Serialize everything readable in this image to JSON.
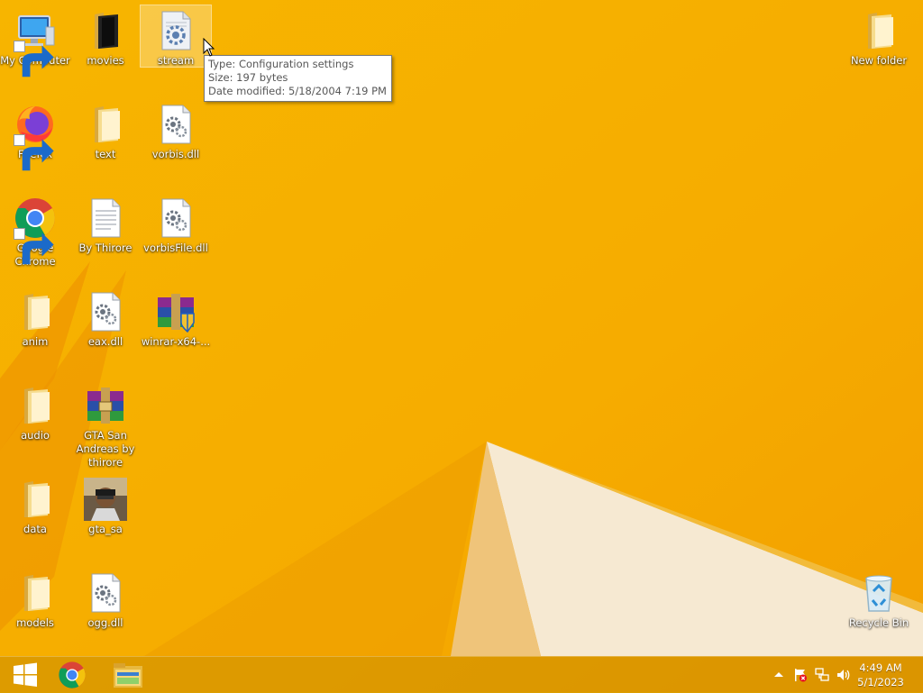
{
  "desktop": {
    "icons": [
      {
        "label": "My Computer",
        "icon": "computer-icon",
        "shortcut": true
      },
      {
        "label": "movies",
        "icon": "folder-icon"
      },
      {
        "label": "stream",
        "icon": "config-file-icon",
        "selected": true
      },
      {
        "label": "New folder",
        "icon": "folder-icon"
      },
      {
        "label": "Firefox",
        "icon": "firefox-icon",
        "shortcut": true
      },
      {
        "label": "text",
        "icon": "folder-icon"
      },
      {
        "label": "vorbis.dll",
        "icon": "dll-file-icon"
      },
      {
        "label": "Google Chrome",
        "icon": "chrome-icon",
        "shortcut": true
      },
      {
        "label": "By Thirore",
        "icon": "text-file-icon"
      },
      {
        "label": "vorbisFile.dll",
        "icon": "dll-file-icon"
      },
      {
        "label": "anim",
        "icon": "folder-icon"
      },
      {
        "label": "eax.dll",
        "icon": "dll-file-icon"
      },
      {
        "label": "winrar-x64-...",
        "icon": "winrar-installer-icon"
      },
      {
        "label": "audio",
        "icon": "folder-icon"
      },
      {
        "label": "GTA San Andreas by thirore",
        "icon": "winrar-archive-icon"
      },
      {
        "label": "data",
        "icon": "folder-icon"
      },
      {
        "label": "gta_sa",
        "icon": "gta-sa-icon"
      },
      {
        "label": "models",
        "icon": "folder-icon"
      },
      {
        "label": "ogg.dll",
        "icon": "dll-file-icon"
      },
      {
        "label": "Recycle Bin",
        "icon": "recycle-bin-icon"
      }
    ]
  },
  "tooltip": {
    "type": "Type: Configuration settings",
    "size": "Size: 197 bytes",
    "modified": "Date modified: 5/18/2004 7:19 PM"
  },
  "taskbar": {
    "start_icon": "windows-start-icon",
    "pinned": [
      "chrome-icon",
      "file-explorer-icon"
    ],
    "tray_icons": [
      "show-hidden-icons-chevron",
      "action-center-flag-icon",
      "network-icon",
      "volume-icon"
    ],
    "clock": {
      "time": "4:49 AM",
      "date": "5/1/2023"
    }
  },
  "colors": {
    "wallpaper": "#f4b400",
    "wallpaper_dark": "#ef8f00",
    "wallpaper_light": "#f7ebd6",
    "folder": "#f3d27a"
  }
}
